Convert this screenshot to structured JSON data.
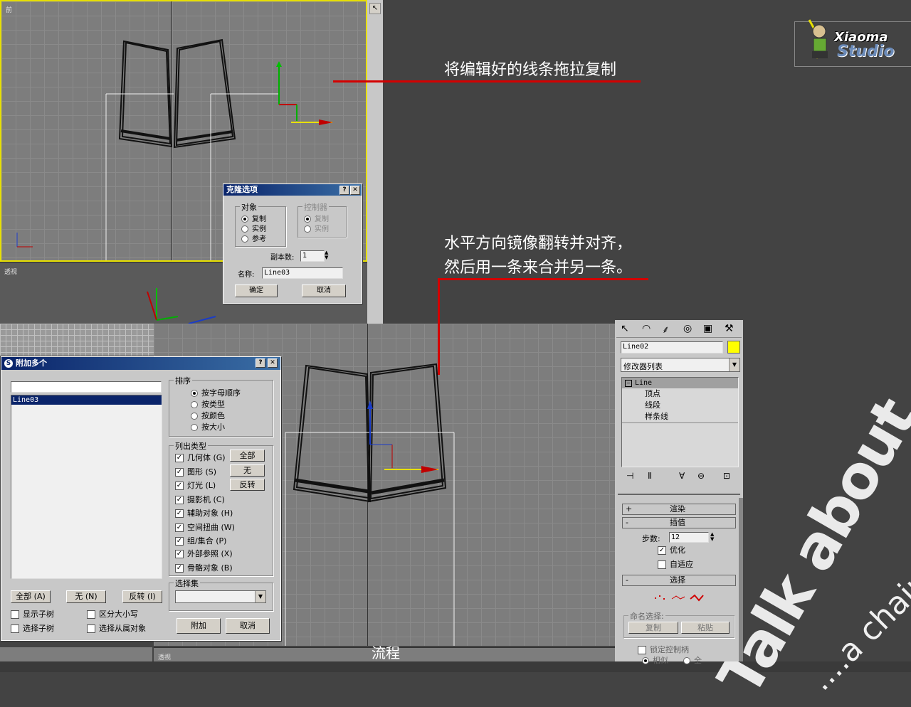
{
  "viewports": {
    "front_label": "前",
    "persp_label": "透视",
    "persp_axes_label": "前",
    "bottom_label": "透视"
  },
  "annotations": {
    "drag_copy": "将编辑好的线条拖拉复制",
    "mirror_line1": "水平方向镜像翻转并对齐，",
    "mirror_line2": "然后用一条来合并另一条。",
    "caption": "流程"
  },
  "logo": {
    "line1": "Xiaoma",
    "line2": "Studio"
  },
  "watermark": {
    "big": "Talk about",
    "small": "....a chair"
  },
  "clone_dialog": {
    "title": "克隆选项",
    "help": "?",
    "close": "✕",
    "object_group": "对象",
    "object_options": [
      "复制",
      "实例",
      "参考"
    ],
    "controller_group": "控制器",
    "controller_options": [
      "复制",
      "实例"
    ],
    "copies_label": "副本数:",
    "copies_value": "1",
    "name_label": "名称:",
    "name_value": "Line03",
    "ok": "确定",
    "cancel": "取消"
  },
  "attach_dialog": {
    "title": "附加多个",
    "help": "?",
    "close": "✕",
    "list_items": [
      "Line03"
    ],
    "sort_group": "排序",
    "sort_options": [
      "按字母顺序",
      "按类型",
      "按颜色",
      "按大小"
    ],
    "list_types_group": "列出类型",
    "types": [
      "几何体 (G)",
      "图形 (S)",
      "灯光 (L)",
      "摄影机 (C)",
      "辅助对象 (H)",
      "空间扭曲 (W)",
      "组/集合 (P)",
      "外部参照 (X)",
      "骨骼对象 (B)"
    ],
    "type_all": "全部",
    "type_none": "无",
    "type_invert": "反转",
    "selection_set_group": "选择集",
    "all_btn": "全部 (A)",
    "none_btn": "无 (N)",
    "invert_btn": "反转 (I)",
    "show_subtree": "显示子树",
    "case_sensitive": "区分大小写",
    "select_subtree": "选择子树",
    "select_dependents": "选择从属对象",
    "attach": "附加",
    "cancel": "取消"
  },
  "command_panel": {
    "object_name": "Line02",
    "color": "#ffff00",
    "modifier_list": "修改器列表",
    "stack_root": "Line",
    "stack_items": [
      "顶点",
      "线段",
      "样条线"
    ],
    "rollout_render": "渲染",
    "rollout_interp": "插值",
    "steps_label": "步数:",
    "steps_value": "12",
    "optimize": "优化",
    "adaptive": "自适应",
    "rollout_select": "选择",
    "named_sel": "命名选择:",
    "copy": "复制",
    "paste": "粘贴",
    "lock_handles": "锁定控制柄",
    "similar": "相似",
    "all": "全"
  }
}
